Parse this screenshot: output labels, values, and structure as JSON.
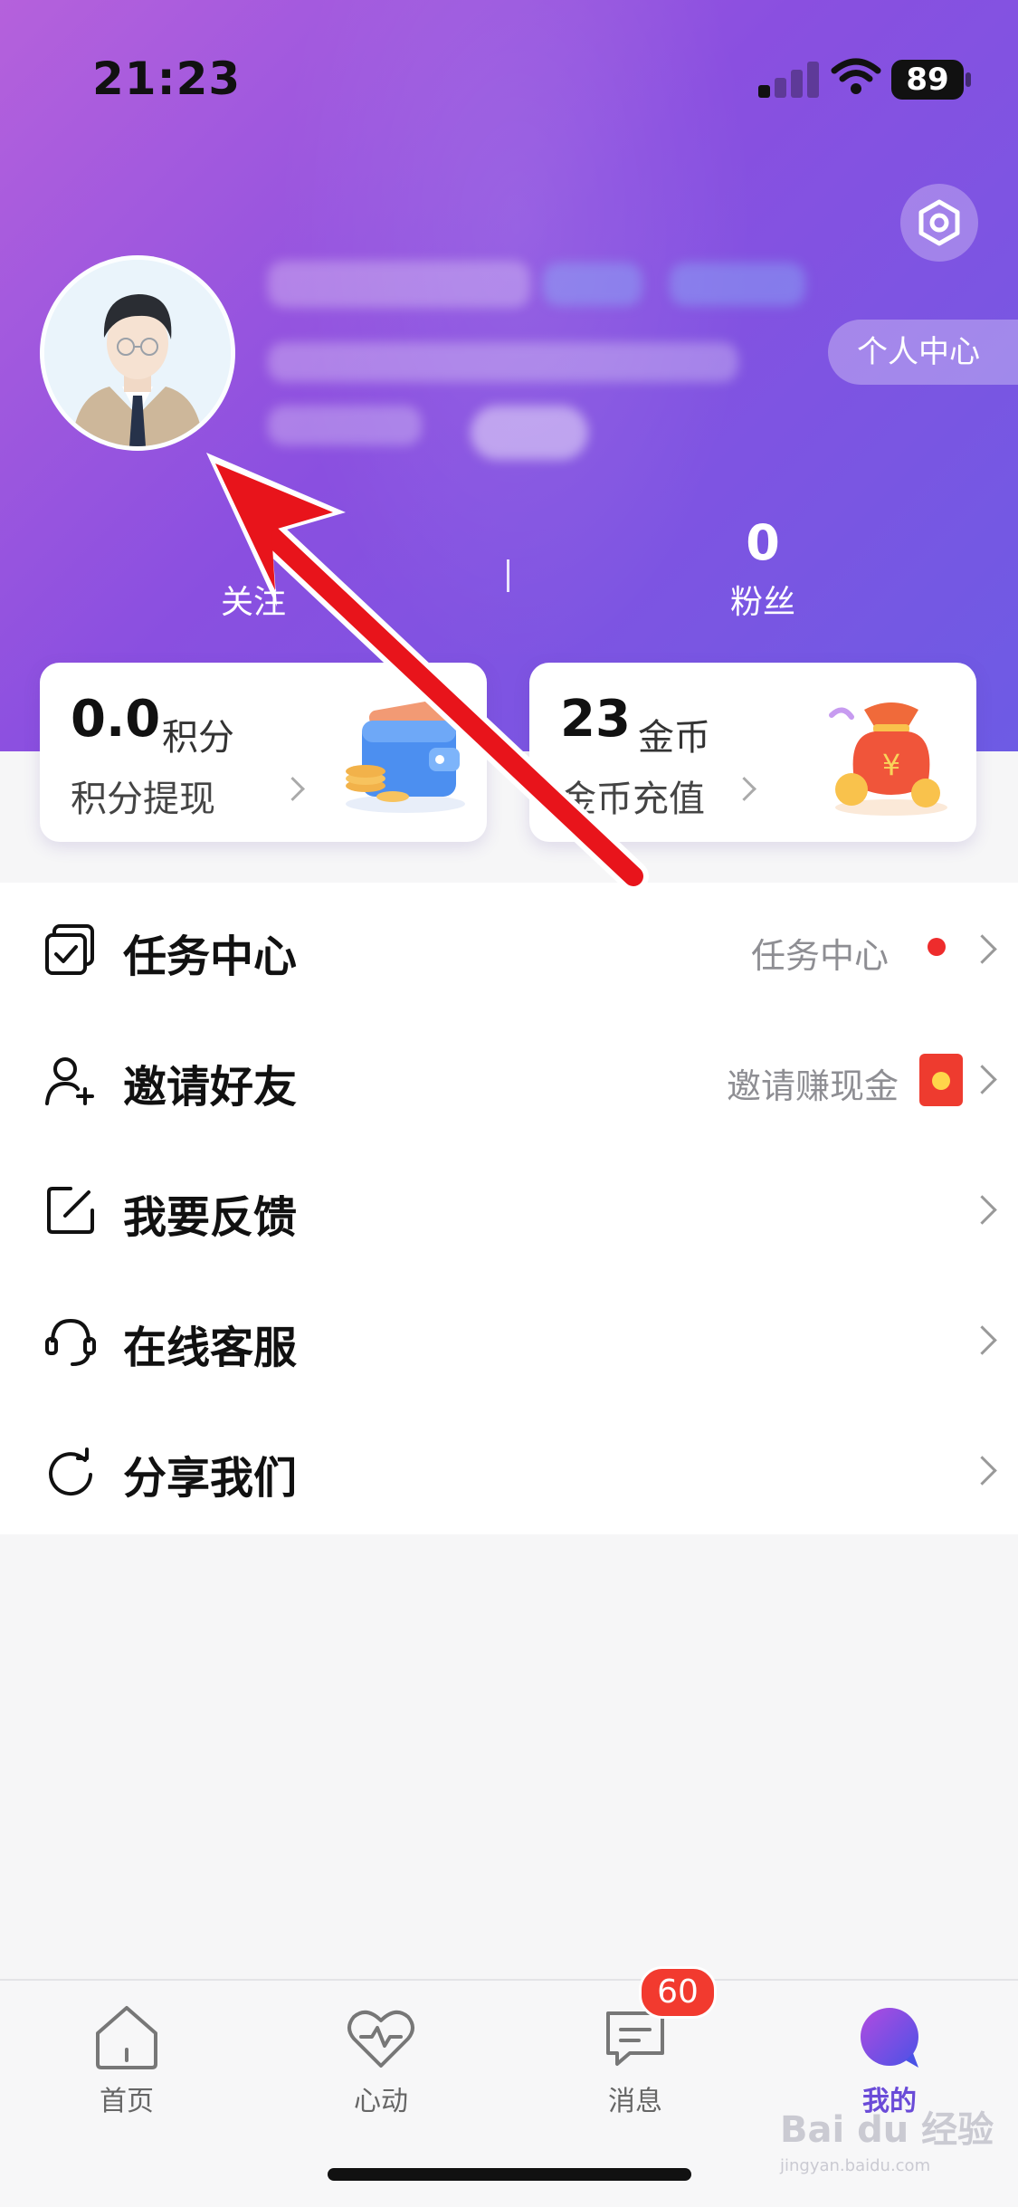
{
  "status_bar": {
    "time": "21:23",
    "battery": "89"
  },
  "profile": {
    "personal_center_label": "个人中心",
    "stats": [
      {
        "count": "",
        "label": "关注"
      },
      {
        "count": "0",
        "label": "粉丝"
      }
    ]
  },
  "cards": [
    {
      "value": "0.0",
      "unit": "积分",
      "action": "积分提现"
    },
    {
      "value": "23",
      "unit": "金币",
      "action": "金币充值"
    }
  ],
  "menu": [
    {
      "title": "任务中心",
      "hint": "任务中心",
      "icon": "task-icon"
    },
    {
      "title": "邀请好友",
      "hint": "邀请赚现金",
      "icon": "invite-user-icon"
    },
    {
      "title": "我要反馈",
      "hint": "",
      "icon": "feedback-edit-icon"
    },
    {
      "title": "在线客服",
      "hint": "",
      "icon": "headset-icon"
    },
    {
      "title": "分享我们",
      "hint": "",
      "icon": "share-icon"
    }
  ],
  "tabbar": {
    "tabs": [
      {
        "label": "首页",
        "icon": "home-icon"
      },
      {
        "label": "心动",
        "icon": "heartbeat-icon"
      },
      {
        "label": "消息",
        "icon": "message-icon"
      },
      {
        "label": "我的",
        "icon": "profile-icon"
      }
    ],
    "message_badge": "60"
  },
  "watermark": {
    "brand": "Bai du 经验",
    "url": "jingyan.baidu.com"
  },
  "colors": {
    "header_start": "#b561dc",
    "header_end": "#6d5be4",
    "active_tab": "#6a4bd8",
    "badge": "#f23a2f",
    "annotation_arrow": "#e8141b"
  }
}
